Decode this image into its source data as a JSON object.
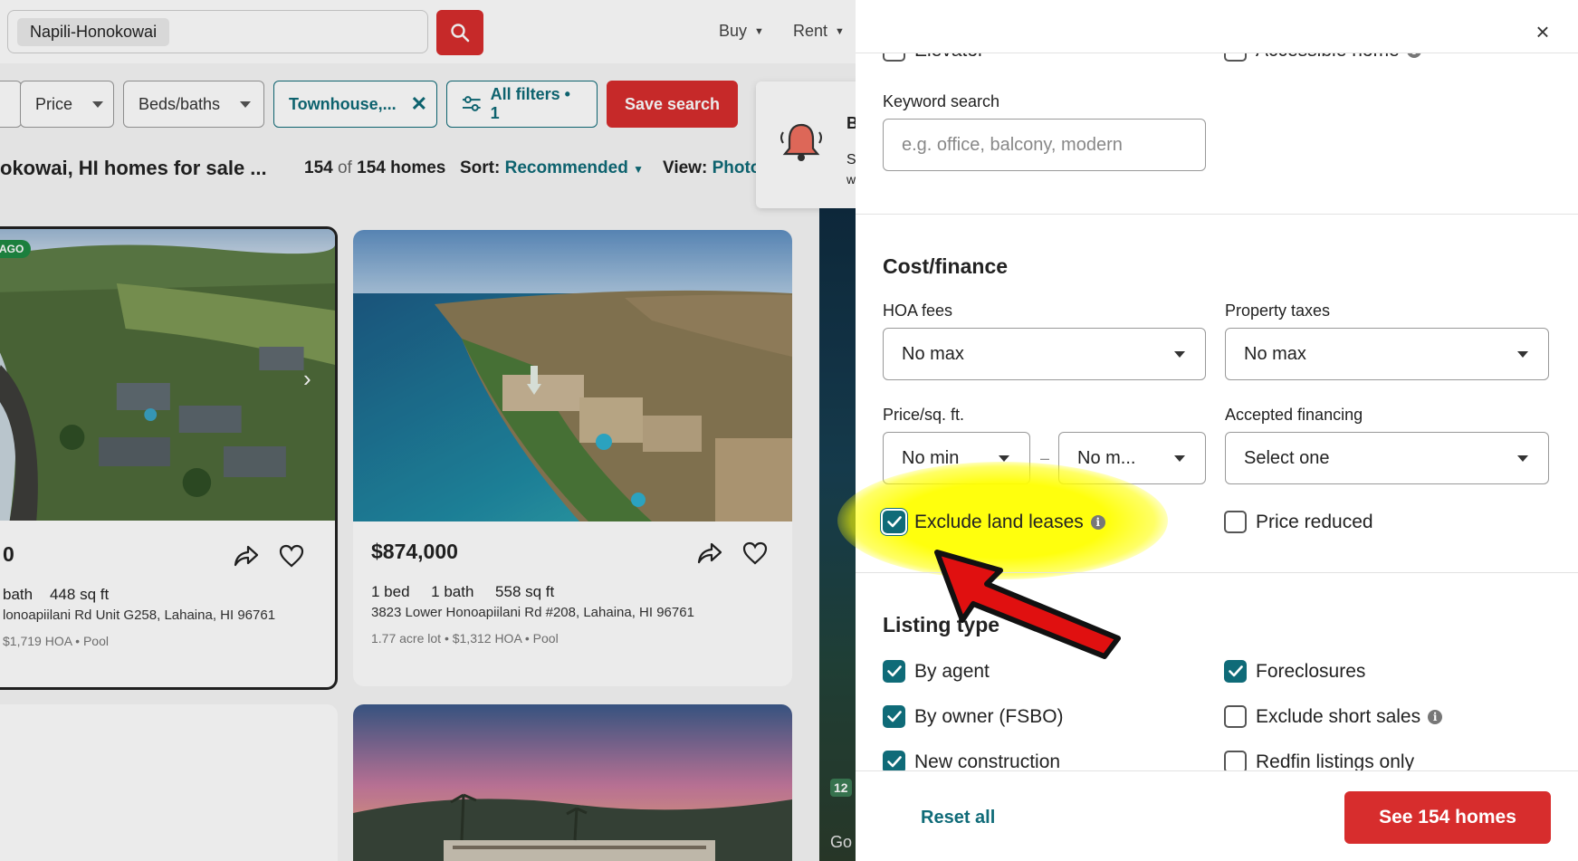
{
  "background": {
    "search": {
      "value": "Napili-Honokowai"
    },
    "nav": {
      "buy": "Buy",
      "rent": "Rent"
    },
    "filters": {
      "price": "Price",
      "beds_baths": "Beds/baths",
      "home_type": "Townhouse,...",
      "all_filters": "All filters • 1",
      "save_search": "Save search"
    },
    "results": {
      "heading": "okowai, HI homes for sale ...",
      "count": "154",
      "count_of": "of",
      "count_total": "154 homes",
      "sort_label": "Sort:",
      "sort_value": "Recommended",
      "view_label": "View:",
      "view_value": "Photo"
    },
    "notif_partial": {
      "line1": "B",
      "line2": "S",
      "line3": "w"
    },
    "listings": [
      {
        "badge": "AGO",
        "price": "0",
        "specs": "bath    448 sq ft",
        "address": "lonoapiilani Rd Unit G258, Lahaina, HI 96761",
        "extra": "$1,719 HOA • Pool"
      },
      {
        "price": "$874,000",
        "specs": "1 bed     1 bath     558 sq ft",
        "address": "3823 Lower Honoapiilani Rd #208, Lahaina, HI 96761",
        "extra": "1.77 acre lot • $1,312 HOA • Pool"
      }
    ],
    "map_badges": {
      "count": "12",
      "google": "Go"
    }
  },
  "panel": {
    "top_checks": {
      "elevator": "Elevator",
      "accessible": "Accessible home"
    },
    "keyword": {
      "label": "Keyword search",
      "placeholder": "e.g. office, balcony, modern"
    },
    "cost": {
      "title": "Cost/finance",
      "hoa_label": "HOA fees",
      "hoa_value": "No max",
      "tax_label": "Property taxes",
      "tax_value": "No max",
      "ppsf_label": "Price/sq. ft.",
      "ppsf_min": "No min",
      "ppsf_max": "No m...",
      "dash": "–",
      "financing_label": "Accepted financing",
      "financing_value": "Select one",
      "exclude_land": "Exclude land leases",
      "price_reduced": "Price reduced"
    },
    "listing_type": {
      "title": "Listing type",
      "by_agent": "By agent",
      "foreclosures": "Foreclosures",
      "by_owner": "By owner (FSBO)",
      "exclude_short": "Exclude short sales",
      "new_construction": "New construction",
      "redfin_only": "Redfin listings only"
    },
    "footer": {
      "reset": "Reset all",
      "see": "See 154 homes"
    },
    "close_glyph": "×",
    "info_glyph": "i"
  },
  "colors": {
    "accent": "#0f6b78",
    "brand_red": "#d72d2d",
    "highlight": "#ffff00",
    "annotation_arrow": "#e01010"
  }
}
